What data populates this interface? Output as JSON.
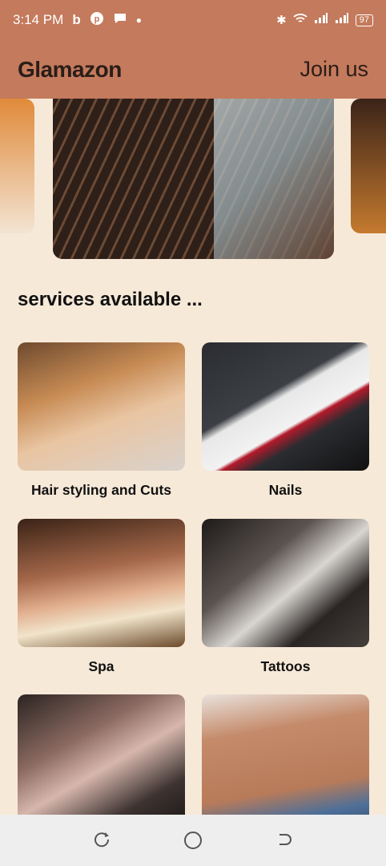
{
  "status_bar": {
    "time": "3:14 PM",
    "icons_left": [
      "bing-icon",
      "pinterest-icon",
      "chat-bubble-icon",
      "dot-icon"
    ],
    "icons_right": [
      "bluetooth-icon",
      "wifi-icon",
      "signal-icon",
      "signal-icon"
    ],
    "battery": "97"
  },
  "app_bar": {
    "title": "Glamazon",
    "join_label": "Join us",
    "background_color": "#c47a5c"
  },
  "carousel": {
    "images": [
      "braids-photo",
      "braids-with-mask-photo",
      "side-photo"
    ]
  },
  "services": {
    "title": "services available ...",
    "items": [
      {
        "label": "Hair styling and Cuts",
        "image": "hair-braids-photo"
      },
      {
        "label": "Nails",
        "image": "nail-polish-swatches-photo"
      },
      {
        "label": "Spa",
        "image": "hot-stone-massage-photo"
      },
      {
        "label": "Tattoos",
        "image": "tattoo-machine-photo"
      },
      {
        "label": "",
        "image": "makeup-collage-photo"
      },
      {
        "label": "",
        "image": "belly-chain-photo"
      }
    ]
  },
  "bottom_nav": {
    "buttons": [
      "recents-icon",
      "home-icon",
      "back-icon"
    ]
  },
  "colors": {
    "page_background": "#f7e9d8",
    "accent": "#c47a5c",
    "nav_background": "#eeeeee"
  }
}
